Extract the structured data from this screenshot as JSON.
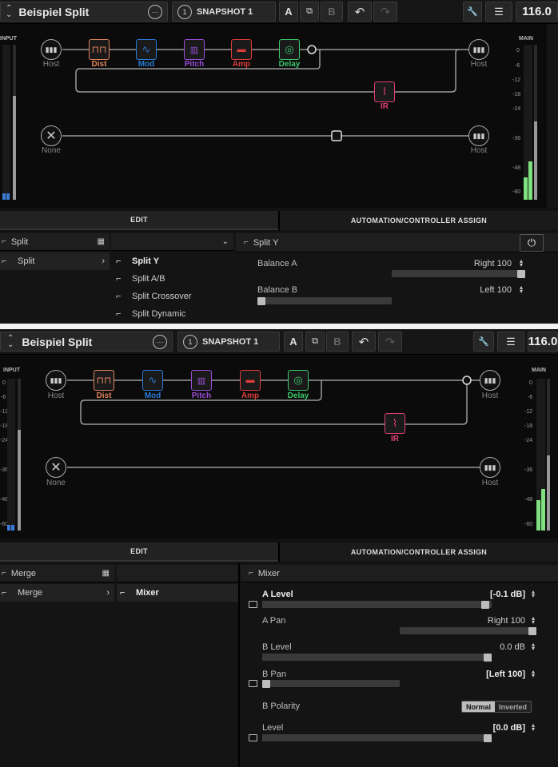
{
  "colors": {
    "dist": "#e0845a",
    "mod": "#2a7bd6",
    "pitch": "#9b4fd8",
    "amp": "#e03c3c",
    "delay": "#3cc86a",
    "ir": "#e0407a",
    "meter_green": "#7ee07e",
    "meter_blue": "#3b7bd8"
  },
  "top": {
    "toolbar": {
      "preset_name": "Beispiel Split",
      "snapshot": "SNAPSHOT 1",
      "snapshot_num": "1",
      "a": "A",
      "b": "B",
      "bpm": "116.0"
    },
    "signal": {
      "host_in": "Host",
      "host_out1": "Host",
      "host_out2": "Host",
      "none": "None",
      "blocks": {
        "dist": "Dist",
        "mod": "Mod",
        "pitch": "Pitch",
        "amp": "Amp",
        "delay": "Delay",
        "ir": "IR"
      }
    },
    "meters": {
      "input_label": "INPUT",
      "main_label": "MAIN",
      "ticks": [
        "0",
        "-6",
        "-12",
        "-18",
        "-24",
        "-36",
        "-48",
        "-60"
      ]
    },
    "tabs": {
      "edit": "EDIT",
      "automation": "AUTOMATION/CONTROLLER ASSIGN"
    },
    "editor": {
      "category": "Split",
      "category_sub": "Split",
      "models": [
        "Split Y",
        "Split A/B",
        "Split Crossover",
        "Split Dynamic"
      ],
      "selected_model": "Split Y",
      "params": [
        {
          "label": "Balance A",
          "value": "Right 100",
          "level": 1.0
        },
        {
          "label": "Balance B",
          "value": "Left 100",
          "level": 0.0
        }
      ]
    }
  },
  "bottom": {
    "toolbar": {
      "preset_name": "Beispiel Split",
      "snapshot": "SNAPSHOT 1",
      "snapshot_num": "1",
      "a": "A",
      "b": "B",
      "bpm": "116.0"
    },
    "signal": {
      "host_in": "Host",
      "host_out1": "Host",
      "host_out2": "Host",
      "none": "None",
      "blocks": {
        "dist": "Dist",
        "mod": "Mod",
        "pitch": "Pitch",
        "amp": "Amp",
        "delay": "Delay",
        "ir": "IR"
      }
    },
    "meters": {
      "input_label": "INPUT",
      "main_label": "MAIN",
      "ticks": [
        "0",
        "-6",
        "-12",
        "-18",
        "-24",
        "-36",
        "-48",
        "-60"
      ]
    },
    "tabs": {
      "edit": "EDIT",
      "automation": "AUTOMATION/CONTROLLER ASSIGN"
    },
    "editor": {
      "category": "Merge",
      "category_sub": "Merge",
      "selected_model": "Mixer",
      "params": [
        {
          "label": "A Level",
          "value": "[-0.1 dB]",
          "level": 0.99
        },
        {
          "label": "A Pan",
          "value": "Right 100",
          "level": 1.0
        },
        {
          "label": "B Level",
          "value": "0.0 dB",
          "level": 1.0
        },
        {
          "label": "B Pan",
          "value": "[Left 100]",
          "level": 0.0
        },
        {
          "label": "B Polarity",
          "options": [
            "Normal",
            "Inverted"
          ],
          "selected": "Normal"
        },
        {
          "label": "Level",
          "value": "[0.0 dB]",
          "level": 1.0
        }
      ]
    }
  }
}
